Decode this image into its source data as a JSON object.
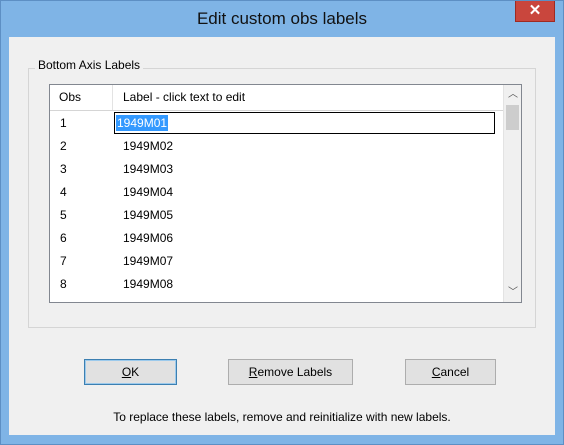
{
  "window": {
    "title": "Edit custom obs labels",
    "close_glyph": "✕"
  },
  "group": {
    "label": "Bottom Axis Labels"
  },
  "grid": {
    "columns": [
      "Obs",
      "Label  - click text to edit"
    ],
    "rows": [
      {
        "obs": "1",
        "label": "1949M01"
      },
      {
        "obs": "2",
        "label": "1949M02"
      },
      {
        "obs": "3",
        "label": "1949M03"
      },
      {
        "obs": "4",
        "label": "1949M04"
      },
      {
        "obs": "5",
        "label": "1949M05"
      },
      {
        "obs": "6",
        "label": "1949M06"
      },
      {
        "obs": "7",
        "label": "1949M07"
      },
      {
        "obs": "8",
        "label": "1949M08"
      }
    ],
    "scroll_up_glyph": "︿",
    "scroll_down_glyph": "﹀"
  },
  "buttons": {
    "ok_mnemonic": "O",
    "ok_rest": "K",
    "remove_mnemonic": "R",
    "remove_rest": "emove Labels",
    "cancel_mnemonic": "C",
    "cancel_rest": "ancel"
  },
  "footer": {
    "text": "To replace these labels, remove and reinitialize with new labels."
  }
}
